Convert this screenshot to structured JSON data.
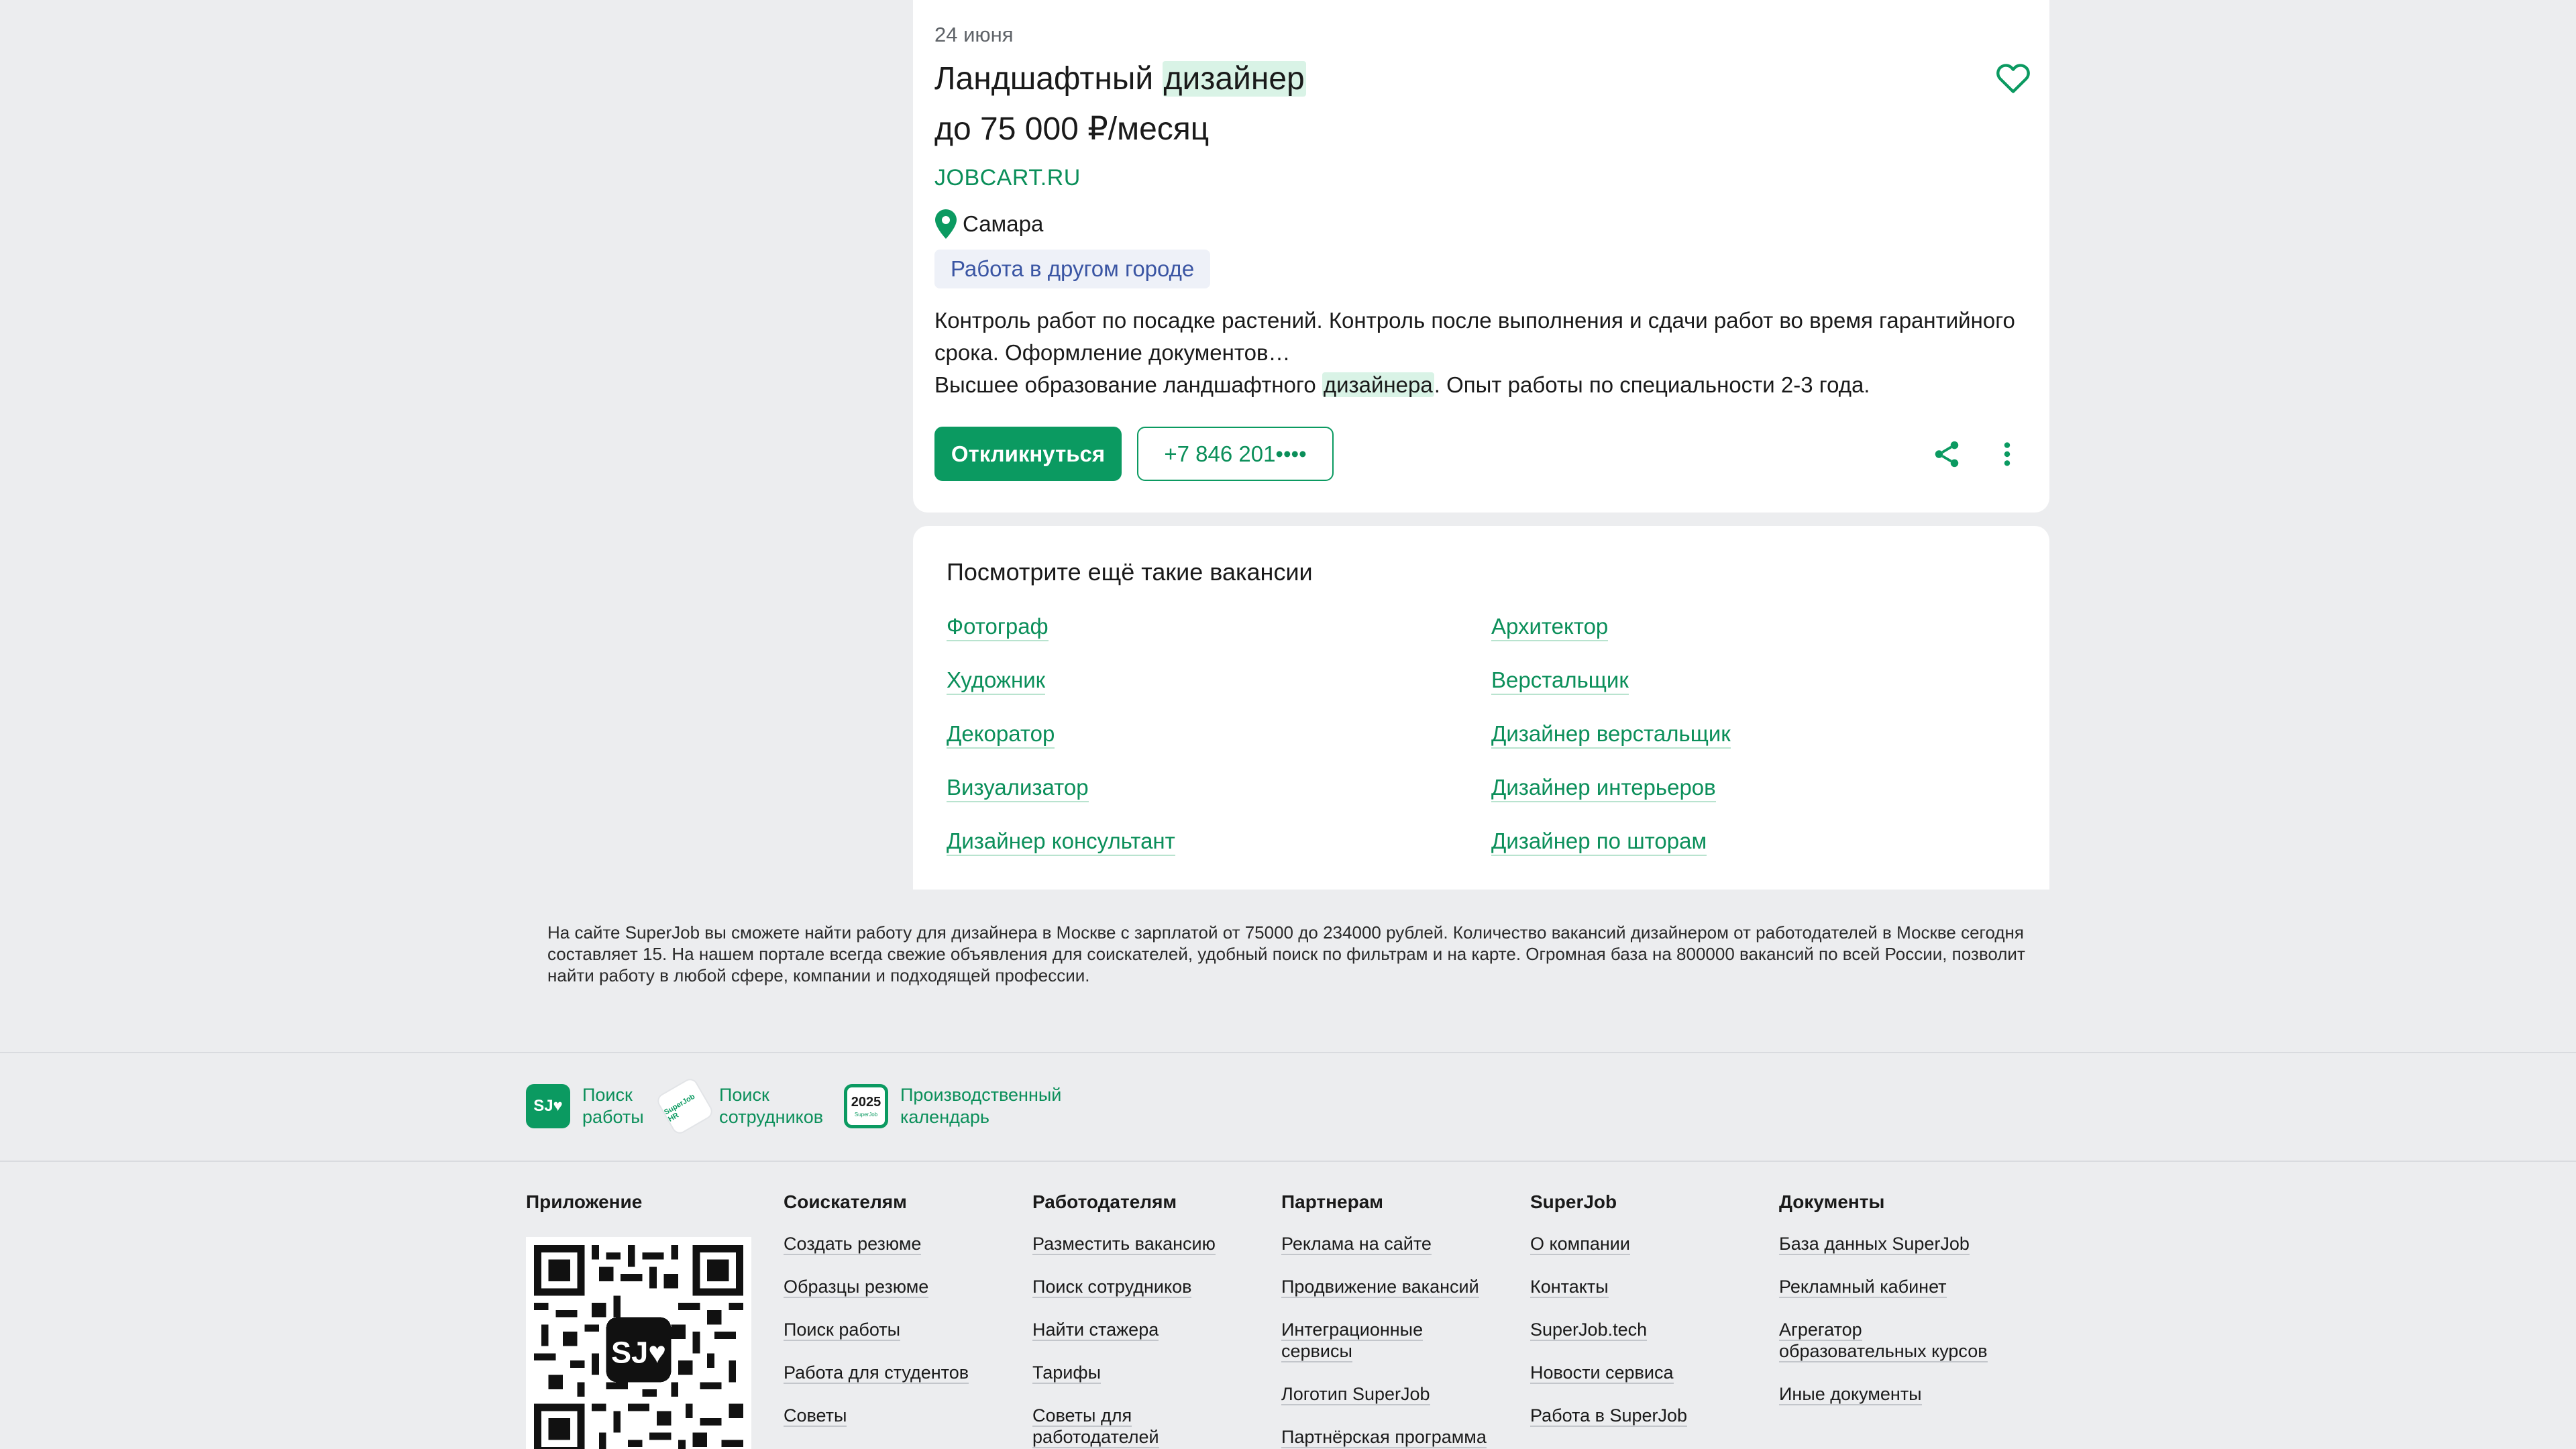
{
  "vacancy": {
    "date": "24 июня",
    "title_part1": "Ландшафтный ",
    "title_highlight": "дизайнер",
    "salary": "до 75 000 ₽/месяц",
    "company": "JOBCART.RU",
    "city": "Самара",
    "tag": "Работа в другом городе",
    "desc_line1": "Контроль работ по посадке растений. Контроль после выполнения и сдачи работ во время гарантийного",
    "desc_line2": "срока. Оформление документов…",
    "desc_line3_a": "Высшее образование ландшафтного ",
    "desc_line3_hl": "дизайнера",
    "desc_line3_b": ". Опыт работы по специальности 2-3 года.",
    "apply_label": "Откликнуться",
    "phone_label": "+7 846 201••••",
    "icons": {
      "favorite": "heart-icon",
      "location": "map-pin-icon",
      "share": "share-icon",
      "more": "more-vertical-icon"
    }
  },
  "similar": {
    "heading": "Посмотрите ещё такие вакансии",
    "left": [
      "Фотограф",
      "Художник",
      "Декоратор",
      "Визуализатор",
      "Дизайнер консультант"
    ],
    "right": [
      "Архитектор",
      "Верстальщик",
      "Дизайнер верстальщик",
      "Дизайнер интерьеров",
      "Дизайнер по шторам"
    ]
  },
  "seo": {
    "text": "На сайте SuperJob вы сможете найти работу для дизайнера в Москве с зарплатой от 75000 до 234000 рублей. Количество вакансий дизайнером от работодателей в Москве сегодня составляет 15. На нашем портале всегда свежие объявления для соискателей, удобный поиск по фильтрам и на карте. Огромная база на 800000 вакансий по всей России, позволит найти работу в любой сфере, компании и подходящей профессии."
  },
  "services": [
    {
      "icon_text": "SJ♥",
      "line1": "Поиск",
      "line2": "работы"
    },
    {
      "icon_text": "SuperJob HR",
      "line1": "Поиск",
      "line2": "сотрудников"
    },
    {
      "icon_text": "2025",
      "icon_sub": "SuperJob",
      "line1": "Производственный",
      "line2": "календарь"
    }
  ],
  "footer": {
    "app": {
      "title": "Приложение",
      "qr_center": "SJ♥"
    },
    "columns": [
      {
        "title": "Соискателям",
        "links": [
          "Создать резюме",
          "Образцы резюме",
          "Поиск работы",
          "Работа для студентов",
          "Советы"
        ]
      },
      {
        "title": "Работодателям",
        "links": [
          "Разместить вакансию",
          "Поиск сотрудников",
          "Найти стажера",
          "Тарифы",
          "Советы для|работодателей"
        ]
      },
      {
        "title": "Партнерам",
        "links": [
          "Реклама на сайте",
          "Продвижение вакансий",
          "Интеграционные|сервисы",
          "Логотип SuperJob",
          "Партнёрская программа"
        ]
      },
      {
        "title": "SuperJob",
        "links": [
          "О компании",
          "Контакты",
          "SuperJob.tech",
          "Новости сервиса",
          "Работа в SuperJob"
        ]
      },
      {
        "title": "Документы",
        "links": [
          "База данных SuperJob",
          "Рекламный кабинет",
          "Агрегатор|образовательных курсов",
          "Иные документы"
        ]
      }
    ]
  },
  "colors": {
    "accent": "#0b9a61",
    "link": "#0b8f5a",
    "highlight": "#d9f3e6",
    "tag_bg": "#eef1f8",
    "tag_text": "#3a55a3",
    "page_bg": "#ecedef"
  }
}
